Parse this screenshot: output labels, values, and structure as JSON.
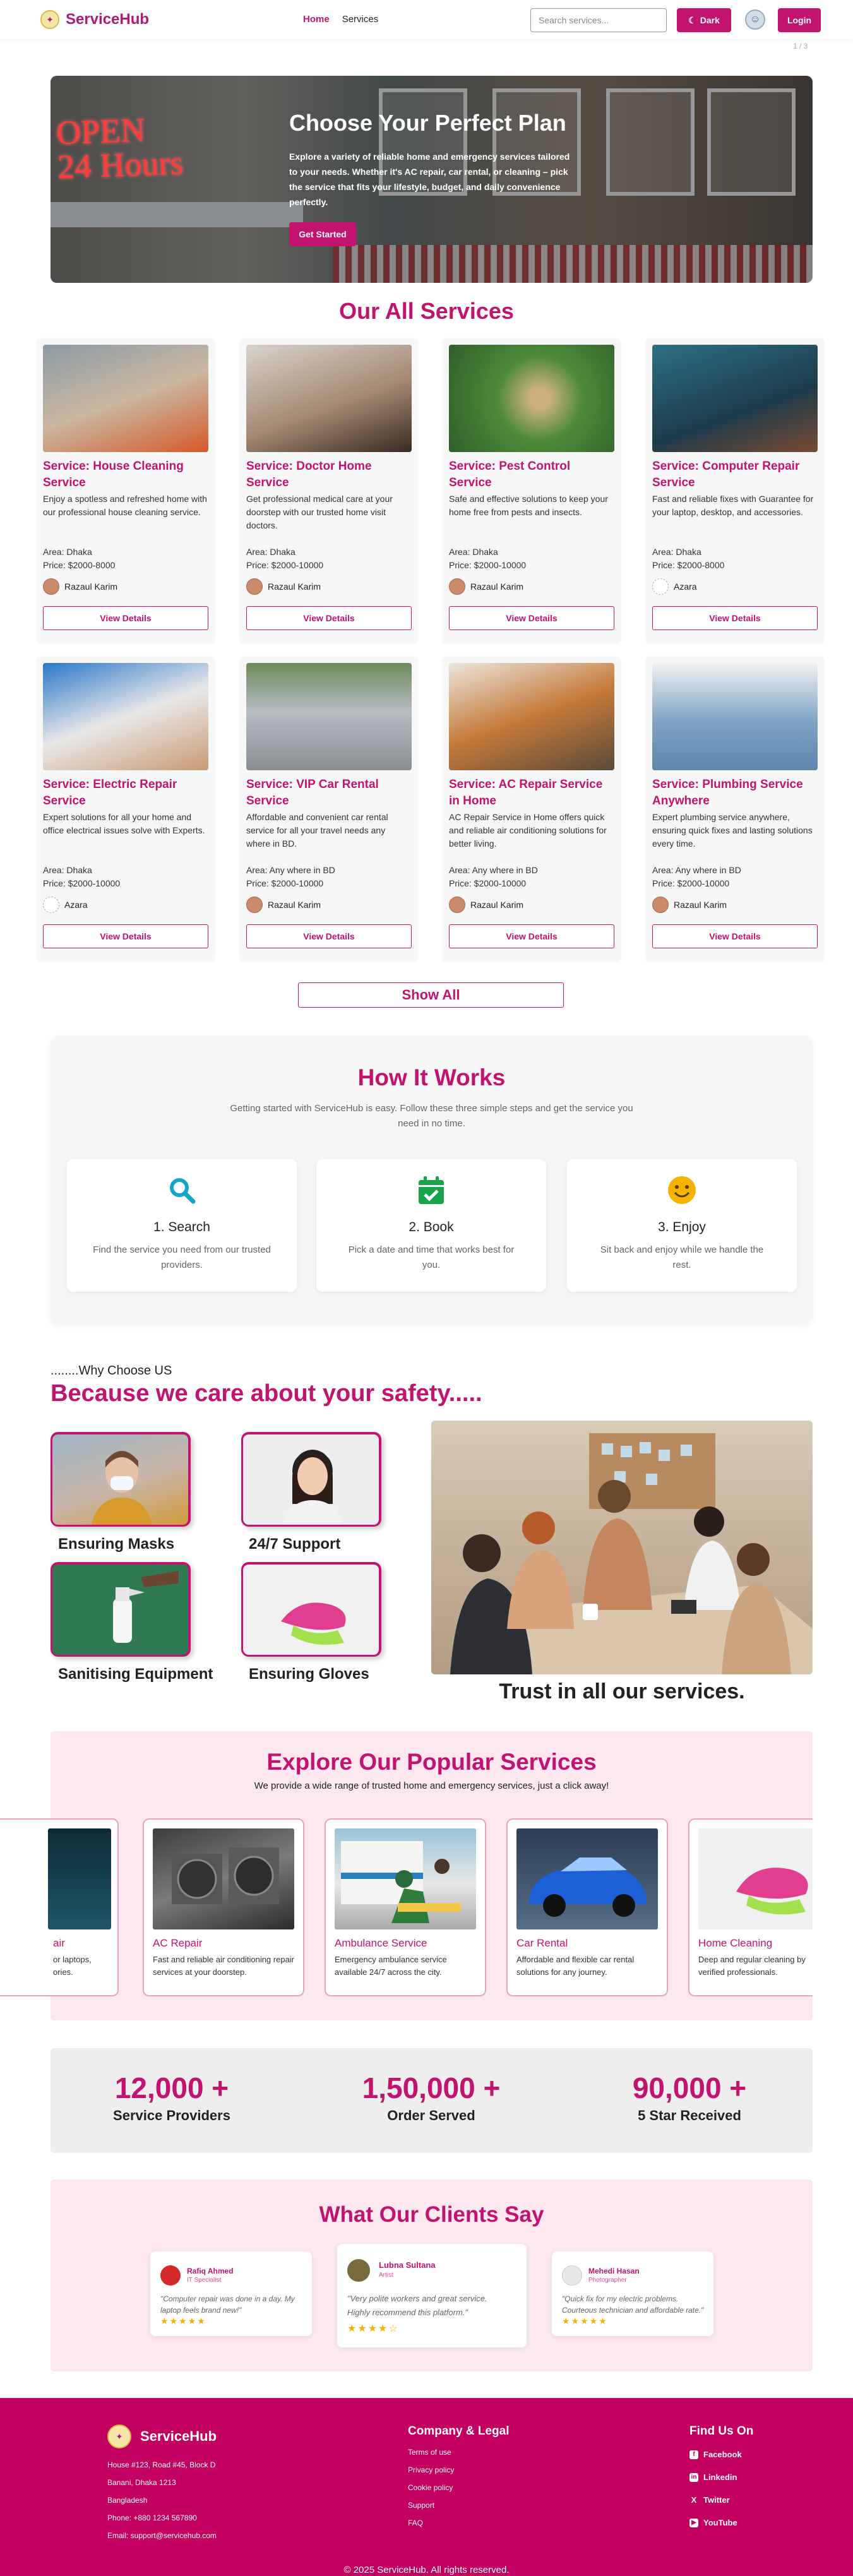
{
  "nav": {
    "brand": "ServiceHub",
    "links": [
      "Home",
      "Services"
    ],
    "search_placeholder": "Search services...",
    "dark_label": "Dark",
    "login_label": "Login",
    "pager": "1 / 3"
  },
  "hero": {
    "title": "Choose Your Perfect Plan",
    "subtitle": "Explore a variety of reliable home and emergency services tailored to your needs. Whether it's AC repair, car rental, or cleaning – pick the service that fits your lifestyle, budget, and daily convenience perfectly.",
    "cta": "Get Started",
    "sign_text": "OPEN 24 Hours"
  },
  "services": {
    "title": "Our All Services",
    "view_label": "View Details",
    "show_all": "Show All",
    "items": [
      {
        "title": "Service: House Cleaning Service",
        "desc": "Enjoy a spotless and refreshed home with our professional house cleaning service.",
        "area": "Area: Dhaka",
        "price": "Price: $2000-8000",
        "owner": "Razaul Karim"
      },
      {
        "title": "Service: Doctor Home Service",
        "desc": "Get professional medical care at your doorstep with our trusted home visit doctors.",
        "area": "Area: Dhaka",
        "price": "Price: $2000-10000",
        "owner": "Razaul Karim"
      },
      {
        "title": "Service: Pest Control Service",
        "desc": "Safe and effective solutions to keep your home free from pests and insects.",
        "area": "Area: Dhaka",
        "price": "Price: $2000-10000",
        "owner": "Razaul Karim"
      },
      {
        "title": "Service: Computer Repair Service",
        "desc": "Fast and reliable fixes with Guarantee for your laptop, desktop, and accessories.",
        "area": "Area: Dhaka",
        "price": "Price: $2000-8000",
        "owner": "Azara"
      },
      {
        "title": "Service: Electric Repair Service",
        "desc": "Expert solutions for all your home and office electrical issues solve with Experts.",
        "area": "Area: Dhaka",
        "price": "Price: $2000-10000",
        "owner": "Azara"
      },
      {
        "title": "Service: VIP Car Rental Service",
        "desc": "Affordable and convenient car rental service for all your travel needs any where in BD.",
        "area": "Area: Any where in BD",
        "price": "Price: $2000-10000",
        "owner": "Razaul Karim"
      },
      {
        "title": "Service: AC Repair Service in Home",
        "desc": "AC Repair Service in Home offers quick and reliable air conditioning solutions for better living.",
        "area": "Area: Any where in BD",
        "price": "Price: $2000-10000",
        "owner": "Razaul Karim"
      },
      {
        "title": "Service: Plumbing Service Anywhere",
        "desc": "Expert plumbing service anywhere, ensuring quick fixes and lasting solutions every time.",
        "area": "Area: Any where in BD",
        "price": "Price: $2000-10000",
        "owner": "Razaul Karim"
      }
    ]
  },
  "how": {
    "title": "How It Works",
    "subtitle": "Getting started with ServiceHub is easy. Follow these three simple steps and get the service you need in no time.",
    "steps": [
      {
        "title": "1. Search",
        "desc": "Find the service you need from our trusted providers.",
        "icon": "search-icon",
        "color": "#12a6c4"
      },
      {
        "title": "2. Book",
        "desc": "Pick a date and time that works best for you.",
        "icon": "calendar-check-icon",
        "color": "#19a34a"
      },
      {
        "title": "3. Enjoy",
        "desc": "Sit back and enjoy while we handle the rest.",
        "icon": "smile-icon",
        "color": "#f5b400"
      }
    ]
  },
  "why": {
    "kicker": "........Why Choose US",
    "title": "Because we care about your safety.....",
    "features": [
      "Ensuring Masks",
      "24/7 Support",
      "Sanitising Equipment",
      "Ensuring Gloves"
    ],
    "trust": "Trust in all our services."
  },
  "explore": {
    "title": "Explore Our Popular Services",
    "subtitle": "We provide a wide range of trusted home and emergency services, just a click away!",
    "items": [
      {
        "title": "Computer Repair",
        "visible_title": "air",
        "desc": "or laptops, ories."
      },
      {
        "title": "AC Repair",
        "desc": "Fast and reliable air conditioning repair services at your doorstep."
      },
      {
        "title": "Ambulance Service",
        "desc": "Emergency ambulance service available 24/7 across the city."
      },
      {
        "title": "Car Rental",
        "desc": "Affordable and flexible car rental solutions for any journey."
      },
      {
        "title": "Home Cleaning",
        "desc": "Deep and regular cleaning by verified professionals."
      }
    ]
  },
  "stats": [
    {
      "value": "12,000 +",
      "label": "Service Providers"
    },
    {
      "value": "1,50,000 +",
      "label": "Order Served"
    },
    {
      "value": "90,000 +",
      "label": "5 Star Received"
    }
  ],
  "testimonials": {
    "title": "What Our Clients Say",
    "items": [
      {
        "name": "Rafiq Ahmed",
        "role": "IT Specialist",
        "text": "\"Computer repair was done in a day. My laptop feels brand new!\"",
        "stars": "★★★★★"
      },
      {
        "name": "Lubna Sultana",
        "role": "Artist",
        "text": "\"Very polite workers and great service. Highly recommend this platform.\"",
        "stars": "★★★★☆"
      },
      {
        "name": "Mehedi Hasan",
        "role": "Photographer",
        "text": "\"Quick fix for my electric problems. Courteous technician and affordable rate.\"",
        "stars": "★★★★★"
      }
    ]
  },
  "footer": {
    "brand": "ServiceHub",
    "address": [
      "House #123, Road #45, Block D",
      "Banani, Dhaka 1213",
      "Bangladesh",
      "Phone: +880 1234 567890",
      "Email: support@servicehub.com"
    ],
    "legal_title": "Company & Legal",
    "legal": [
      "Terms of use",
      "Privacy policy",
      "Cookie policy",
      "Support",
      "FAQ"
    ],
    "social_title": "Find Us On",
    "social": [
      "Facebook",
      "Linkedin",
      "Twitter",
      "YouTube"
    ],
    "copyright": "© 2025 ServiceHub. All rights reserved."
  },
  "colors": {
    "brand": "#c2136f",
    "footer": "#c2005f",
    "soft_pink": "#fde8f0"
  }
}
